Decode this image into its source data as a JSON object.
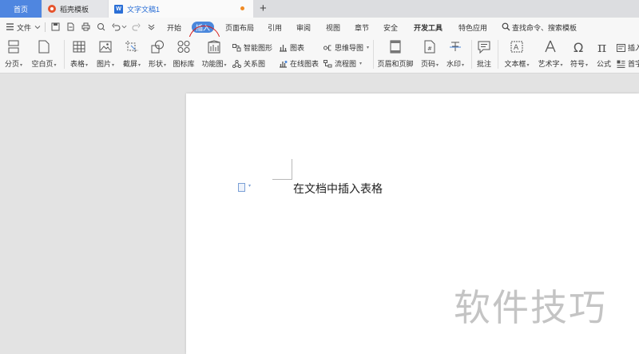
{
  "tabs": {
    "home": "首页",
    "daoke": "稻壳模板",
    "doc": "文字文稿1",
    "doc_badge": "W",
    "new_tab": "+"
  },
  "menu": {
    "file": "文件",
    "start": "开始",
    "insert": "插入",
    "page_layout": "页面布局",
    "reference": "引用",
    "review": "审阅",
    "view": "视图",
    "chapter": "章节",
    "security": "安全",
    "dev_tools": "开发工具",
    "features": "特色应用",
    "search": "查找命令、搜索模板"
  },
  "ribbon": {
    "page_break": "分页",
    "blank_page": "空白页",
    "table": "表格",
    "picture": "图片",
    "screenshot": "截屏",
    "shape": "形状",
    "icon_lib": "图标库",
    "function_chart": "功能图",
    "smart_art": "智能图形",
    "chart": "图表",
    "mind_map": "思维导图",
    "relation": "关系图",
    "online_chart": "在线图表",
    "flow_chart": "流程图",
    "header_footer": "页眉和页脚",
    "page_number": "页码",
    "watermark": "水印",
    "comment": "批注",
    "text_box": "文本框",
    "word_art": "艺术字",
    "symbol": "符号",
    "formula": "公式",
    "insert_extra": "插入",
    "drop_cap": "首字"
  },
  "document": {
    "body_text": "在文档中插入表格"
  },
  "watermark_text": "软件技巧",
  "colors": {
    "accent": "#4a87dc",
    "annotation": "#d71d1d",
    "home_tab": "#4f86e0"
  }
}
